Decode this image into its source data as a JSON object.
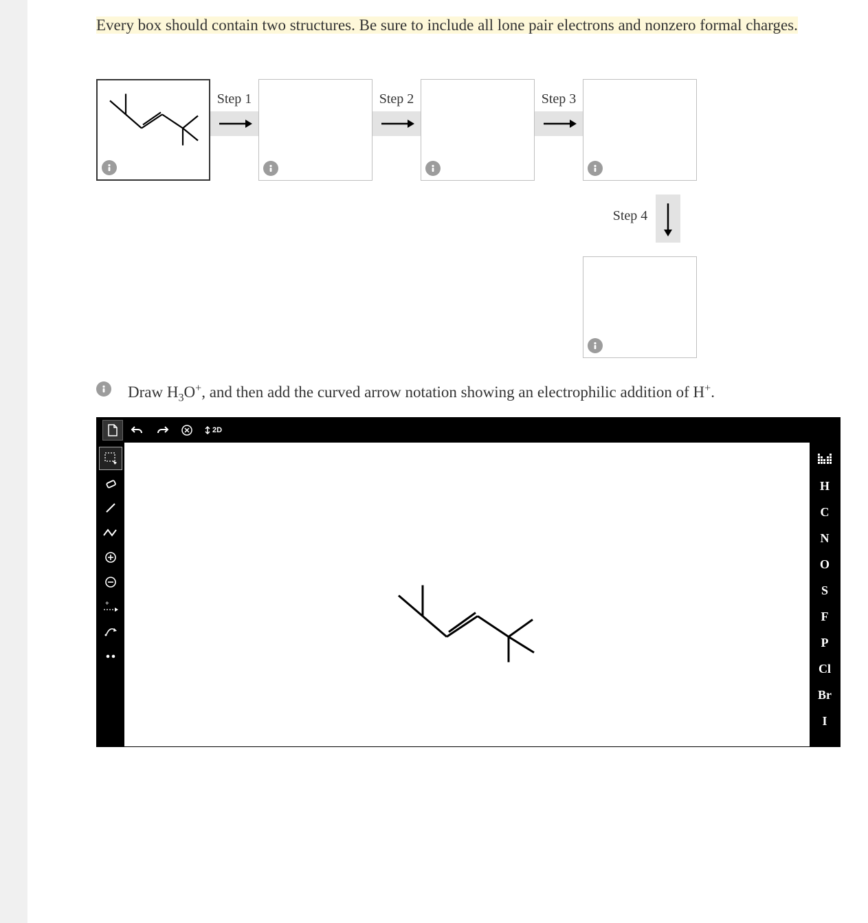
{
  "instructions": "Every box should contain two structures. Be sure to include all lone pair electrons and nonzero formal charges.",
  "steps": {
    "s1": "Step 1",
    "s2": "Step 2",
    "s3": "Step 3",
    "s4": "Step 4"
  },
  "hint": {
    "pre": "Draw H",
    "sub1": "3",
    "mid1": "O",
    "sup1": "+",
    "mid2": ", and then add the curved arrow notation showing an electrophilic addition of H",
    "sup2": "+",
    "post": "."
  },
  "editor": {
    "cleanup_label": "2D"
  },
  "elements": {
    "H": "H",
    "C": "C",
    "N": "N",
    "O": "O",
    "S": "S",
    "F": "F",
    "P": "P",
    "Cl": "Cl",
    "Br": "Br",
    "I": "I"
  }
}
